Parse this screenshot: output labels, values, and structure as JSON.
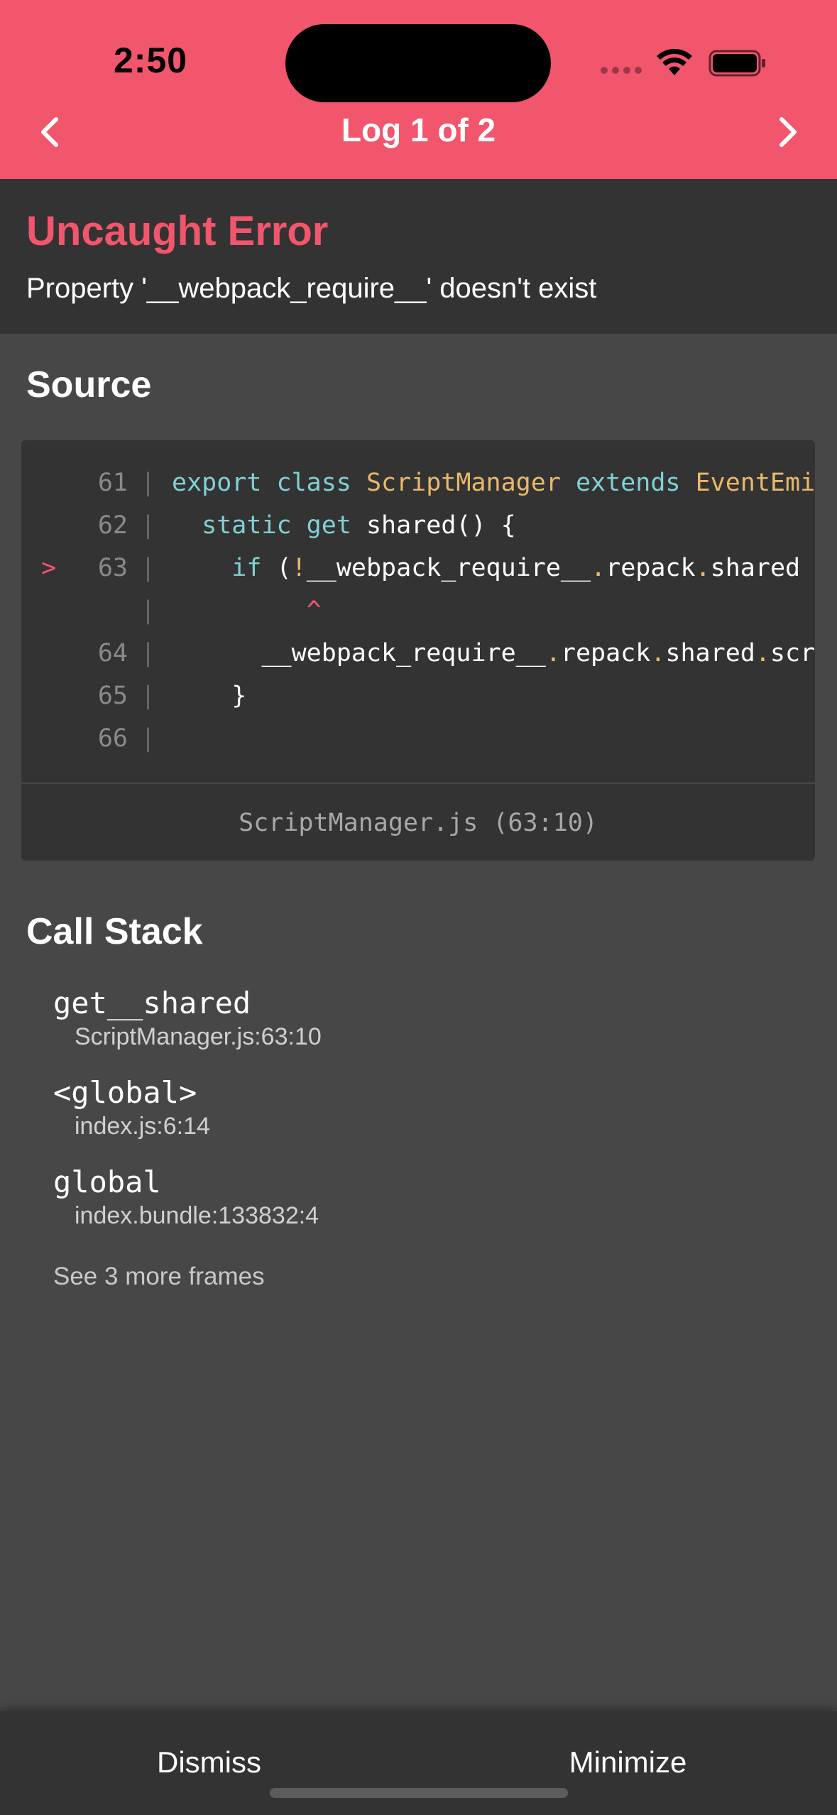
{
  "status_bar": {
    "time": "2:50"
  },
  "header": {
    "title": "Log 1 of 2",
    "prev_icon": "chevron-left-icon",
    "next_icon": "chevron-right-icon"
  },
  "error": {
    "title": "Uncaught Error",
    "message": "Property '__webpack_require__' doesn't exist"
  },
  "source": {
    "heading": "Source",
    "lines": [
      {
        "number": "61",
        "marker": ""
      },
      {
        "number": "62",
        "marker": ""
      },
      {
        "number": "63",
        "marker": ">"
      },
      {
        "number": "",
        "marker": ""
      },
      {
        "number": "64",
        "marker": ""
      },
      {
        "number": "65",
        "marker": ""
      },
      {
        "number": "66",
        "marker": ""
      }
    ],
    "code": {
      "l61_kw1": "export",
      "l61_kw2": "class",
      "l61_cls1": "ScriptManager",
      "l61_kw3": "extends",
      "l61_cls2": "EventEmitter {",
      "l62_kw1": "static",
      "l62_kw2": "get",
      "l62_rest": "shared() {",
      "l63_kw": "if",
      "l63_paren": "(",
      "l63_bang": "!",
      "l63_a": "__webpack_require__",
      "l63_dot1": ".",
      "l63_b": "repack",
      "l63_dot2": ".",
      "l63_c": "shared",
      "caret": "^",
      "l64_a": "__webpack_require__",
      "l64_dot1": ".",
      "l64_b": "repack",
      "l64_dot2": ".",
      "l64_c": "shared",
      "l64_dot3": ".",
      "l64_d": "scriptManager",
      "l65": "}"
    },
    "file_location": "ScriptManager.js (63:10)"
  },
  "call_stack": {
    "heading": "Call Stack",
    "frames": [
      {
        "name": "get__shared",
        "location": "ScriptManager.js:63:10"
      },
      {
        "name": "<global>",
        "location": "index.js:6:14"
      },
      {
        "name": "global",
        "location": "index.bundle:133832:4"
      }
    ],
    "more_label": "See 3 more frames"
  },
  "footer": {
    "dismiss_label": "Dismiss",
    "minimize_label": "Minimize"
  }
}
